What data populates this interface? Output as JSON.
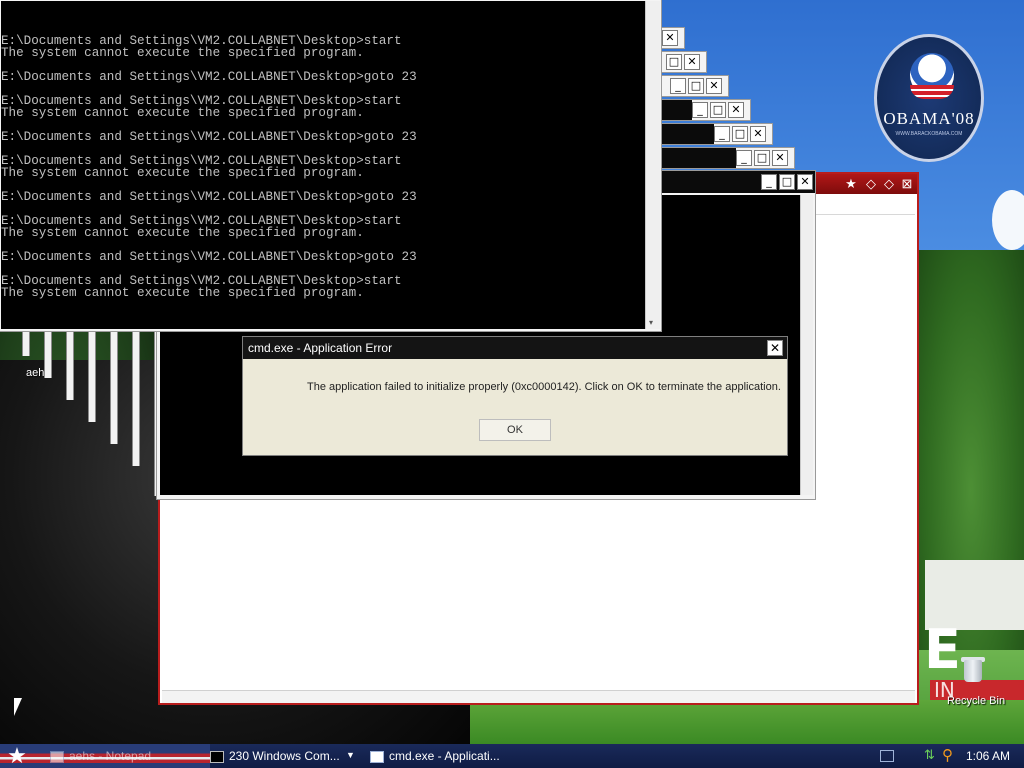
{
  "desktop": {
    "logo_text": "OBAMA'08",
    "logo_url": "WWW.BARACKOBAMA.COM",
    "icon_partial_label": "aeh",
    "recycle_bin_label": "Recycle Bin",
    "partial_e": "E",
    "partial_in": "IN"
  },
  "console": {
    "lines": [
      "E:\\Documents and Settings\\VM2.COLLABNET\\Desktop>start",
      "The system cannot execute the specified program.",
      "",
      "E:\\Documents and Settings\\VM2.COLLABNET\\Desktop>goto 23",
      "",
      "E:\\Documents and Settings\\VM2.COLLABNET\\Desktop>start",
      "The system cannot execute the specified program.",
      "",
      "E:\\Documents and Settings\\VM2.COLLABNET\\Desktop>goto 23",
      "",
      "E:\\Documents and Settings\\VM2.COLLABNET\\Desktop>start",
      "The system cannot execute the specified program.",
      "",
      "E:\\Documents and Settings\\VM2.COLLABNET\\Desktop>goto 23",
      "",
      "E:\\Documents and Settings\\VM2.COLLABNET\\Desktop>start",
      "The system cannot execute the specified program.",
      "",
      "E:\\Documents and Settings\\VM2.COLLABNET\\Desktop>goto 23",
      "",
      "E:\\Documents and Settings\\VM2.COLLABNET\\Desktop>start",
      "The system cannot execute the specified program."
    ]
  },
  "window_buttons": {
    "minimize": "_",
    "maximize": "□",
    "close": "✕"
  },
  "dialog": {
    "title": "cmd.exe - Application Error",
    "message": "The application failed to initialize properly (0xc0000142). Click on OK to terminate the application.",
    "ok_label": "OK",
    "close_glyph": "✕"
  },
  "taskbar": {
    "start_glyph": "★",
    "items": [
      {
        "label": "aehs - Notepad",
        "icon": "notepad-icon"
      },
      {
        "label": "230 Windows Com...",
        "icon": "cmd-icon"
      },
      {
        "label": "cmd.exe - Applicati...",
        "icon": "window-icon"
      }
    ],
    "clock": "1:06 AM"
  }
}
